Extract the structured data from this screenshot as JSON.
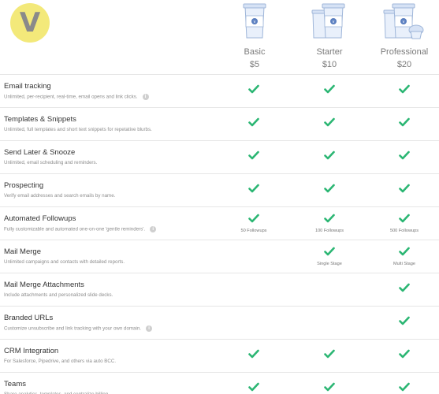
{
  "logo": {
    "letter": "V"
  },
  "plans": [
    {
      "name": "Basic",
      "price": "$5"
    },
    {
      "name": "Starter",
      "price": "$10"
    },
    {
      "name": "Professional",
      "price": "$20"
    }
  ],
  "colors": {
    "check": "#2bb673",
    "logo_bg": "#f3e97a"
  },
  "features": [
    {
      "title": "Email tracking",
      "desc": "Unlimited, per-recipient, real-time, email opens and link clicks.",
      "info": true,
      "cells": [
        {
          "check": true,
          "note": ""
        },
        {
          "check": true,
          "note": ""
        },
        {
          "check": true,
          "note": ""
        }
      ]
    },
    {
      "title": "Templates & Snippets",
      "desc": "Unlimited, full templates and short text snippets for repetative blurbs.",
      "info": false,
      "cells": [
        {
          "check": true,
          "note": ""
        },
        {
          "check": true,
          "note": ""
        },
        {
          "check": true,
          "note": ""
        }
      ]
    },
    {
      "title": "Send Later & Snooze",
      "desc": "Unlimited, email scheduling and reminders.",
      "info": false,
      "cells": [
        {
          "check": true,
          "note": ""
        },
        {
          "check": true,
          "note": ""
        },
        {
          "check": true,
          "note": ""
        }
      ]
    },
    {
      "title": "Prospecting",
      "desc": "Verify email addresses and search emails by name.",
      "info": false,
      "cells": [
        {
          "check": true,
          "note": ""
        },
        {
          "check": true,
          "note": ""
        },
        {
          "check": true,
          "note": ""
        }
      ]
    },
    {
      "title": "Automated Followups",
      "desc": "Fully customizable and automated one-on-one 'gentle reminders'.",
      "info": true,
      "cells": [
        {
          "check": true,
          "note": "50 Followups"
        },
        {
          "check": true,
          "note": "100 Followups"
        },
        {
          "check": true,
          "note": "500 Followups"
        }
      ]
    },
    {
      "title": "Mail Merge",
      "desc": "Unlimited campaigns and contacts with detailed reports.",
      "info": false,
      "cells": [
        {
          "check": false,
          "note": ""
        },
        {
          "check": true,
          "note": "Single Stage"
        },
        {
          "check": true,
          "note": "Multi Stage"
        }
      ]
    },
    {
      "title": "Mail Merge Attachments",
      "desc": "Include attachments and personalized slide decks.",
      "info": false,
      "cells": [
        {
          "check": false,
          "note": ""
        },
        {
          "check": false,
          "note": ""
        },
        {
          "check": true,
          "note": ""
        }
      ]
    },
    {
      "title": "Branded URLs",
      "desc": "Customize unsubscribe and link tracking with your own domain.",
      "info": true,
      "cells": [
        {
          "check": false,
          "note": ""
        },
        {
          "check": false,
          "note": ""
        },
        {
          "check": true,
          "note": ""
        }
      ]
    },
    {
      "title": "CRM Integration",
      "desc": "For Salesforce, Pipedrive, and others via auto BCC.",
      "info": false,
      "cells": [
        {
          "check": true,
          "note": ""
        },
        {
          "check": true,
          "note": ""
        },
        {
          "check": true,
          "note": ""
        }
      ]
    },
    {
      "title": "Teams",
      "desc": "Share analytics, templates, and centralize billing.",
      "info": false,
      "cells": [
        {
          "check": true,
          "note": ""
        },
        {
          "check": true,
          "note": ""
        },
        {
          "check": true,
          "note": ""
        }
      ]
    }
  ]
}
